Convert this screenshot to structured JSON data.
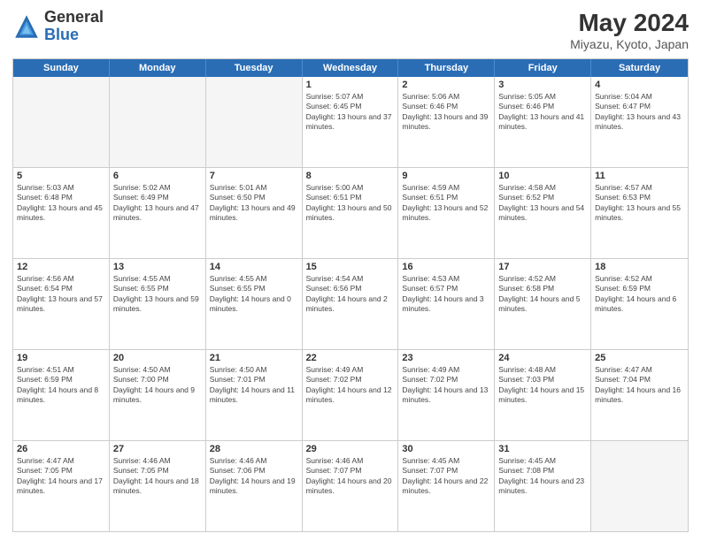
{
  "logo": {
    "general": "General",
    "blue": "Blue"
  },
  "title": {
    "month_year": "May 2024",
    "location": "Miyazu, Kyoto, Japan"
  },
  "header_days": [
    "Sunday",
    "Monday",
    "Tuesday",
    "Wednesday",
    "Thursday",
    "Friday",
    "Saturday"
  ],
  "weeks": [
    [
      {
        "day": "",
        "info": ""
      },
      {
        "day": "",
        "info": ""
      },
      {
        "day": "",
        "info": ""
      },
      {
        "day": "1",
        "info": "Sunrise: 5:07 AM\nSunset: 6:45 PM\nDaylight: 13 hours and 37 minutes."
      },
      {
        "day": "2",
        "info": "Sunrise: 5:06 AM\nSunset: 6:46 PM\nDaylight: 13 hours and 39 minutes."
      },
      {
        "day": "3",
        "info": "Sunrise: 5:05 AM\nSunset: 6:46 PM\nDaylight: 13 hours and 41 minutes."
      },
      {
        "day": "4",
        "info": "Sunrise: 5:04 AM\nSunset: 6:47 PM\nDaylight: 13 hours and 43 minutes."
      }
    ],
    [
      {
        "day": "5",
        "info": "Sunrise: 5:03 AM\nSunset: 6:48 PM\nDaylight: 13 hours and 45 minutes."
      },
      {
        "day": "6",
        "info": "Sunrise: 5:02 AM\nSunset: 6:49 PM\nDaylight: 13 hours and 47 minutes."
      },
      {
        "day": "7",
        "info": "Sunrise: 5:01 AM\nSunset: 6:50 PM\nDaylight: 13 hours and 49 minutes."
      },
      {
        "day": "8",
        "info": "Sunrise: 5:00 AM\nSunset: 6:51 PM\nDaylight: 13 hours and 50 minutes."
      },
      {
        "day": "9",
        "info": "Sunrise: 4:59 AM\nSunset: 6:51 PM\nDaylight: 13 hours and 52 minutes."
      },
      {
        "day": "10",
        "info": "Sunrise: 4:58 AM\nSunset: 6:52 PM\nDaylight: 13 hours and 54 minutes."
      },
      {
        "day": "11",
        "info": "Sunrise: 4:57 AM\nSunset: 6:53 PM\nDaylight: 13 hours and 55 minutes."
      }
    ],
    [
      {
        "day": "12",
        "info": "Sunrise: 4:56 AM\nSunset: 6:54 PM\nDaylight: 13 hours and 57 minutes."
      },
      {
        "day": "13",
        "info": "Sunrise: 4:55 AM\nSunset: 6:55 PM\nDaylight: 13 hours and 59 minutes."
      },
      {
        "day": "14",
        "info": "Sunrise: 4:55 AM\nSunset: 6:55 PM\nDaylight: 14 hours and 0 minutes."
      },
      {
        "day": "15",
        "info": "Sunrise: 4:54 AM\nSunset: 6:56 PM\nDaylight: 14 hours and 2 minutes."
      },
      {
        "day": "16",
        "info": "Sunrise: 4:53 AM\nSunset: 6:57 PM\nDaylight: 14 hours and 3 minutes."
      },
      {
        "day": "17",
        "info": "Sunrise: 4:52 AM\nSunset: 6:58 PM\nDaylight: 14 hours and 5 minutes."
      },
      {
        "day": "18",
        "info": "Sunrise: 4:52 AM\nSunset: 6:59 PM\nDaylight: 14 hours and 6 minutes."
      }
    ],
    [
      {
        "day": "19",
        "info": "Sunrise: 4:51 AM\nSunset: 6:59 PM\nDaylight: 14 hours and 8 minutes."
      },
      {
        "day": "20",
        "info": "Sunrise: 4:50 AM\nSunset: 7:00 PM\nDaylight: 14 hours and 9 minutes."
      },
      {
        "day": "21",
        "info": "Sunrise: 4:50 AM\nSunset: 7:01 PM\nDaylight: 14 hours and 11 minutes."
      },
      {
        "day": "22",
        "info": "Sunrise: 4:49 AM\nSunset: 7:02 PM\nDaylight: 14 hours and 12 minutes."
      },
      {
        "day": "23",
        "info": "Sunrise: 4:49 AM\nSunset: 7:02 PM\nDaylight: 14 hours and 13 minutes."
      },
      {
        "day": "24",
        "info": "Sunrise: 4:48 AM\nSunset: 7:03 PM\nDaylight: 14 hours and 15 minutes."
      },
      {
        "day": "25",
        "info": "Sunrise: 4:47 AM\nSunset: 7:04 PM\nDaylight: 14 hours and 16 minutes."
      }
    ],
    [
      {
        "day": "26",
        "info": "Sunrise: 4:47 AM\nSunset: 7:05 PM\nDaylight: 14 hours and 17 minutes."
      },
      {
        "day": "27",
        "info": "Sunrise: 4:46 AM\nSunset: 7:05 PM\nDaylight: 14 hours and 18 minutes."
      },
      {
        "day": "28",
        "info": "Sunrise: 4:46 AM\nSunset: 7:06 PM\nDaylight: 14 hours and 19 minutes."
      },
      {
        "day": "29",
        "info": "Sunrise: 4:46 AM\nSunset: 7:07 PM\nDaylight: 14 hours and 20 minutes."
      },
      {
        "day": "30",
        "info": "Sunrise: 4:45 AM\nSunset: 7:07 PM\nDaylight: 14 hours and 22 minutes."
      },
      {
        "day": "31",
        "info": "Sunrise: 4:45 AM\nSunset: 7:08 PM\nDaylight: 14 hours and 23 minutes."
      },
      {
        "day": "",
        "info": ""
      }
    ]
  ]
}
